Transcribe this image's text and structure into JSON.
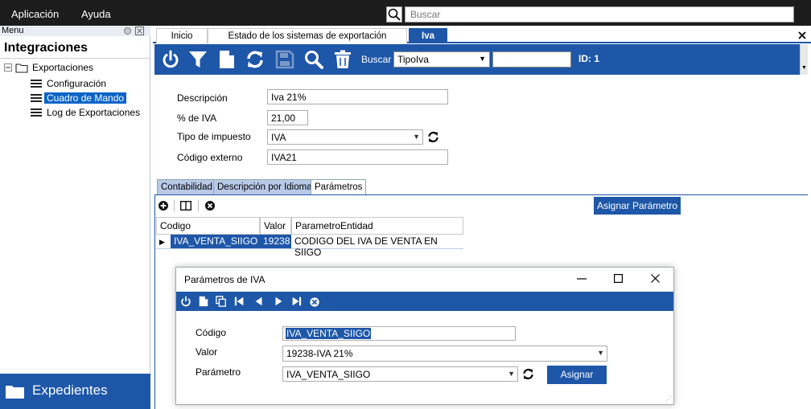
{
  "menubar": {
    "items": [
      "Aplicación",
      "Ayuda"
    ],
    "search_placeholder": "Buscar"
  },
  "sidebar": {
    "menu_label": "Menu",
    "title": "Integraciones",
    "tree": {
      "root": "Exportaciones",
      "children": [
        "Configuración",
        "Cuadro de Mando",
        "Log de Exportaciones"
      ],
      "selected": "Cuadro de Mando"
    },
    "bottom_button": "Expedientes"
  },
  "tabs": [
    "Inicio",
    "Estado de los sistemas de exportación",
    "Iva"
  ],
  "active_tab": "Iva",
  "toolbar": {
    "buscar_label": "Buscar",
    "search_field": "TipoIva",
    "search_value": "",
    "id_label": "ID: 1"
  },
  "form": {
    "descripcion": {
      "label": "Descripción",
      "value": "Iva 21%"
    },
    "porcentaje": {
      "label": "% de IVA",
      "value": "21,00"
    },
    "tipo_impuesto": {
      "label": "Tipo de impuesto",
      "value": "IVA"
    },
    "codigo_externo": {
      "label": "Código externo",
      "value": "IVA21"
    }
  },
  "lower_tabs": [
    "Contabilidad",
    "Descripción por Idioma",
    "Parámetros"
  ],
  "lower_active_tab": "Parámetros",
  "assign_param_label": "Asignar Parámetro",
  "grid": {
    "columns": [
      "Codigo",
      "Valor",
      "ParametroEntidad"
    ],
    "rows": [
      [
        "IVA_VENTA_SIIGO",
        "19238",
        "CODIGO DEL IVA DE VENTA EN SIIGO"
      ]
    ]
  },
  "dialog": {
    "title": "Parámetros de IVA",
    "codigo": {
      "label": "Código",
      "value": "IVA_VENTA_SIIGO"
    },
    "valor": {
      "label": "Valor",
      "value": "19238-IVA 21%"
    },
    "parametro": {
      "label": "Parámetro",
      "value": "IVA_VENTA_SIIGO"
    },
    "assign_button": "Asignar"
  },
  "colors": {
    "brand_blue": "#1e57a8",
    "selection_blue": "#0a64c8",
    "menubar": "#1c1c1c"
  }
}
